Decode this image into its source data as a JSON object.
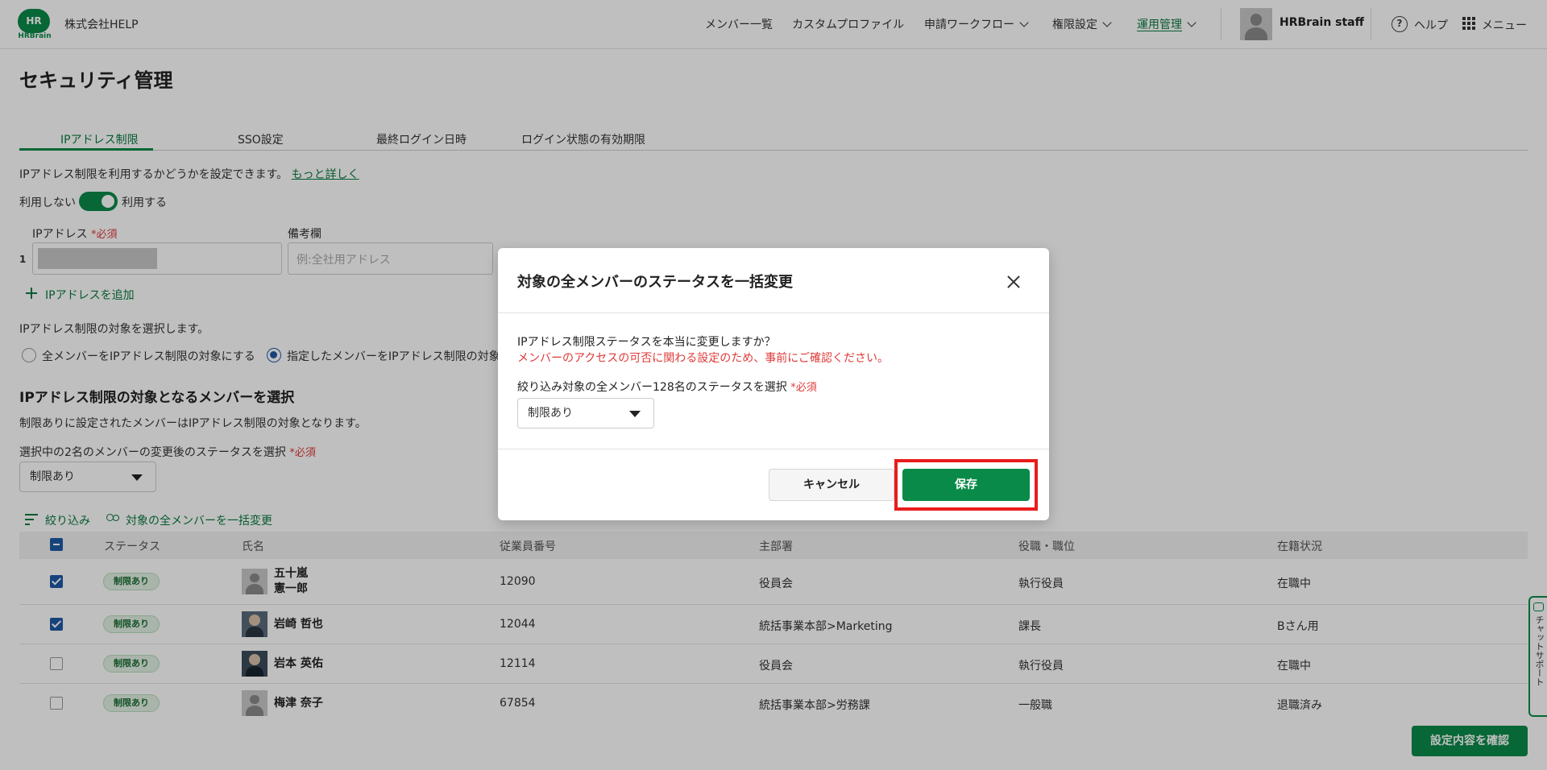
{
  "header": {
    "logo_text": "HR",
    "logo_brand": "HRBrain",
    "company": "株式会社HELP",
    "nav": [
      {
        "label": "メンバー一覧"
      },
      {
        "label": "カスタムプロファイル"
      },
      {
        "label": "申請ワークフロー"
      },
      {
        "label": "権限設定"
      },
      {
        "label": "運用管理"
      }
    ],
    "user": "HRBrain staff",
    "help_label": "ヘルプ",
    "menu_label": "メニュー"
  },
  "page": {
    "title": "セキュリティ管理",
    "tabs": [
      "IPアドレス制限",
      "SSO設定",
      "最終ログイン日時",
      "ログイン状態の有効期限"
    ],
    "desc": "IPアドレス制限を利用するかどうかを設定できます。",
    "desc_link": "もっと詳しく",
    "toggle_off_label": "利用しない",
    "toggle_on_label": "利用する",
    "ip_label": "IPアドレス",
    "required": "*必須",
    "note_label": "備考欄",
    "row_number": "1",
    "note_placeholder": "例:全社用アドレス",
    "add_ip": "IPアドレスを追加",
    "target_desc": "IPアドレス制限の対象を選択します。",
    "radio_all": "全メンバーをIPアドレス制限の対象にする",
    "radio_specified": "指定したメンバーをIPアドレス制限の対象",
    "section_title": "IPアドレス制限の対象となるメンバーを選択",
    "section_desc": "制限ありに設定されたメンバーはIPアドレス制限の対象となります。",
    "selected_status_label": "選択中の2名のメンバーの変更後のステータスを選択",
    "selected_status_value": "制限あり",
    "filter_label": "絞り込み",
    "bulk_label": "対象の全メンバーを一括変更",
    "confirm_button": "設定内容を確認",
    "chat_label": "チャットサポート"
  },
  "table": {
    "columns": [
      "ステータス",
      "氏名",
      "従業員番号",
      "主部署",
      "役職・職位",
      "在籍状況"
    ],
    "rows": [
      {
        "checked": true,
        "status": "制限あり",
        "name_line1": "五十嵐",
        "name_line2": "憲一郎",
        "emp_no": "12090",
        "dept": "役員会",
        "position": "執行役員",
        "employment": "在職中"
      },
      {
        "checked": true,
        "status": "制限あり",
        "name_line1": "岩崎 哲也",
        "name_line2": "",
        "emp_no": "12044",
        "dept": "統括事業本部>Marketing",
        "position": "課長",
        "employment": "Bさん用"
      },
      {
        "checked": false,
        "status": "制限あり",
        "name_line1": "岩本 英佑",
        "name_line2": "",
        "emp_no": "12114",
        "dept": "役員会",
        "position": "執行役員",
        "employment": "在職中"
      },
      {
        "checked": false,
        "status": "制限あり",
        "name_line1": "梅津 奈子",
        "name_line2": "",
        "emp_no": "67854",
        "dept": "統括事業本部>労務課",
        "position": "一般職",
        "employment": "退職済み"
      }
    ]
  },
  "modal": {
    "title": "対象の全メンバーのステータスを一括変更",
    "question": "IPアドレス制限ステータスを本当に変更しますか？",
    "warning": "メンバーのアクセスの可否に関わる設定のため、事前にご確認ください。",
    "select_label": "絞り込み対象の全メンバー128名のステータスを選択",
    "required": "*必須",
    "select_value": "制限あり",
    "cancel": "キャンセル",
    "save": "保存"
  }
}
